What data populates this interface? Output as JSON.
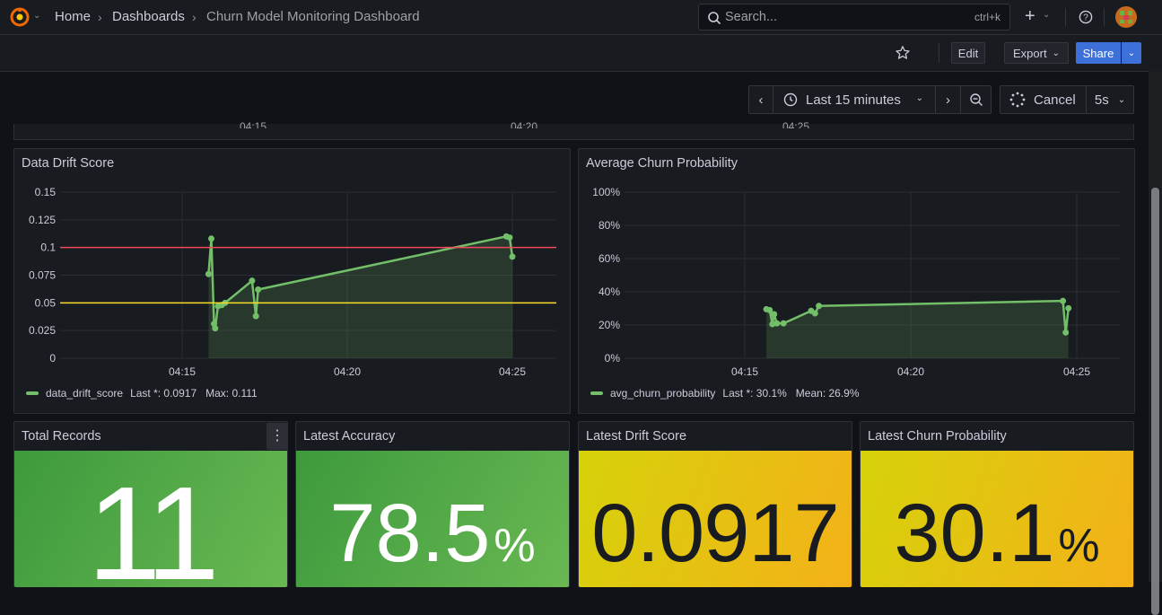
{
  "breadcrumb": {
    "home": "Home",
    "dashboards": "Dashboards",
    "current": "Churn Model Monitoring Dashboard"
  },
  "search": {
    "placeholder": "Search...",
    "shortcut": "ctrl+k"
  },
  "toolbar": {
    "edit": "Edit",
    "export": "Export",
    "share": "Share"
  },
  "timepicker": {
    "range": "Last 15 minutes",
    "cancel": "Cancel",
    "refresh": "5s"
  },
  "prev_panel_ticks": [
    "04:15",
    "04:20",
    "04:25"
  ],
  "colors": {
    "green": "#73bf69",
    "red": "#f2495c",
    "yellow": "#fade2a",
    "accent": "#3d71d9"
  },
  "panels": {
    "drift": {
      "title": "Data Drift Score",
      "legend_name": "data_drift_score",
      "legend_stats": "Last *: 0.0917   Max: 0.111"
    },
    "churn": {
      "title": "Average Churn Probability",
      "legend_name": "avg_churn_probability",
      "legend_stats": "Last *: 30.1%   Mean: 26.9%"
    },
    "total": {
      "title": "Total Records",
      "value": "11"
    },
    "accuracy": {
      "title": "Latest Accuracy",
      "value": "78.5",
      "unit": "%"
    },
    "drift_stat": {
      "title": "Latest Drift Score",
      "value": "0.0917"
    },
    "churn_stat": {
      "title": "Latest Churn Probability",
      "value": "30.1",
      "unit": "%"
    }
  },
  "chart_data": [
    {
      "type": "line",
      "title": "Data Drift Score",
      "series": [
        {
          "name": "data_drift_score",
          "color": "#73bf69",
          "x": [
            "04:15:48",
            "04:15:53",
            "04:15:58",
            "04:16:00",
            "04:16:05",
            "04:16:12",
            "04:16:18",
            "04:17:07",
            "04:17:14",
            "04:17:18",
            "04:24:49",
            "04:24:55",
            "04:25:00"
          ],
          "values": [
            0.076,
            0.108,
            0.031,
            0.027,
            0.047,
            0.048,
            0.05,
            0.07,
            0.038,
            0.062,
            0.11,
            0.109,
            0.0917
          ]
        }
      ],
      "thresholds": [
        {
          "value": 0.1,
          "color": "#f2495c"
        },
        {
          "value": 0.05,
          "color": "#fade2a"
        }
      ],
      "x_ticks": [
        "04:15",
        "04:20",
        "04:25"
      ],
      "y_ticks": [
        "0",
        "0.025",
        "0.05",
        "0.075",
        "0.1",
        "0.125",
        "0.15"
      ],
      "ylim": [
        0,
        0.15
      ]
    },
    {
      "type": "line",
      "title": "Average Churn Probability",
      "series": [
        {
          "name": "avg_churn_probability",
          "color": "#73bf69",
          "x": [
            "04:15:39",
            "04:15:45",
            "04:15:50",
            "04:15:53",
            "04:15:58",
            "04:16:10",
            "04:17:00",
            "04:17:07",
            "04:17:14",
            "04:24:35",
            "04:24:40",
            "04:24:45"
          ],
          "values": [
            0.295,
            0.29,
            0.205,
            0.265,
            0.21,
            0.21,
            0.285,
            0.27,
            0.315,
            0.345,
            0.155,
            0.301
          ]
        }
      ],
      "x_ticks": [
        "04:15",
        "04:20",
        "04:25"
      ],
      "y_ticks": [
        "0%",
        "20%",
        "40%",
        "60%",
        "80%",
        "100%"
      ],
      "ylim": [
        0,
        1
      ]
    }
  ]
}
